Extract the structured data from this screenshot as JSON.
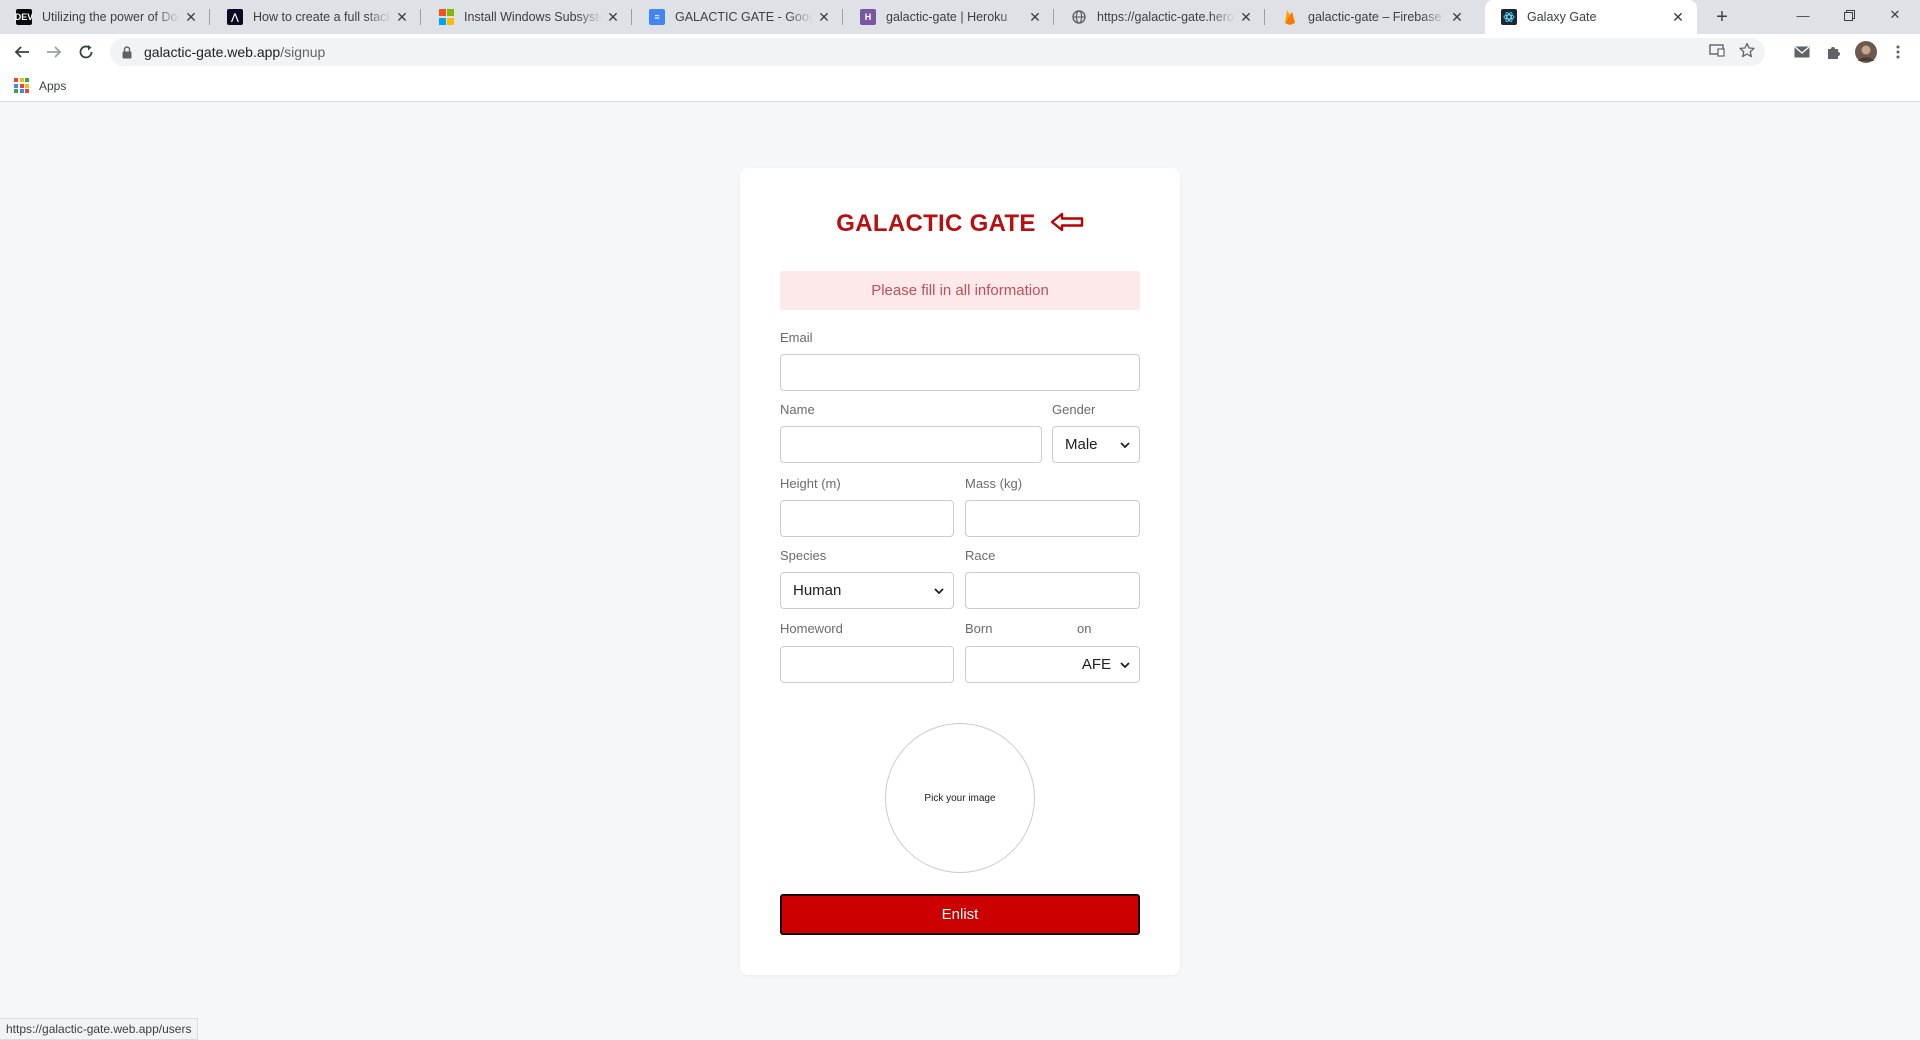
{
  "browser": {
    "tabs": [
      {
        "title": "Utilizing the power of Docker",
        "favicon": "DEV",
        "favicon_color": "#0a0a0a",
        "active": false
      },
      {
        "title": "How to create a full stack React",
        "favicon": "A",
        "favicon_color": "#0a0a23",
        "active": false
      },
      {
        "title": "Install Windows Subsystem for Linux",
        "favicon": "ms",
        "favicon_color": "#f25022",
        "active": false
      },
      {
        "title": "GALACTIC GATE - Google Docs",
        "favicon": "doc",
        "favicon_color": "#4285f4",
        "active": false
      },
      {
        "title": "galactic-gate | Heroku",
        "favicon": "H",
        "favicon_color": "#79589f",
        "active": false
      },
      {
        "title": "https://galactic-gate.herokuapp.com",
        "favicon": "globe",
        "favicon_color": "#5f6368",
        "active": false
      },
      {
        "title": "galactic-gate – Firebase console",
        "favicon": "fire",
        "favicon_color": "#ffa000",
        "active": false
      },
      {
        "title": "Galaxy Gate",
        "favicon": "react",
        "favicon_color": "#1c2733",
        "active": true
      }
    ],
    "url_host": "galactic-gate.web.app",
    "url_path": "/signup",
    "bookmarks": {
      "apps_label": "Apps"
    },
    "status_url": "https://galactic-gate.web.app/users"
  },
  "form": {
    "brand": "GALACTIC GATE",
    "brand_color": "#b80f0f",
    "alert": "Please fill in all information",
    "email_label": "Email",
    "email_value": "",
    "name_label": "Name",
    "name_value": "",
    "gender_label": "Gender",
    "gender_value": "Male",
    "height_label": "Height (m)",
    "height_value": "",
    "mass_label": "Mass (kg)",
    "mass_value": "",
    "species_label": "Species",
    "species_value": "Human",
    "race_label": "Race",
    "race_value": "",
    "homeworld_label": "Homeword",
    "homeworld_value": "",
    "born_label": "Born",
    "born_on_label": "on",
    "born_value": "",
    "born_era_value": "AFE",
    "image_picker": "Pick your image",
    "submit": "Enlist",
    "submit_color": "#cc0000"
  }
}
